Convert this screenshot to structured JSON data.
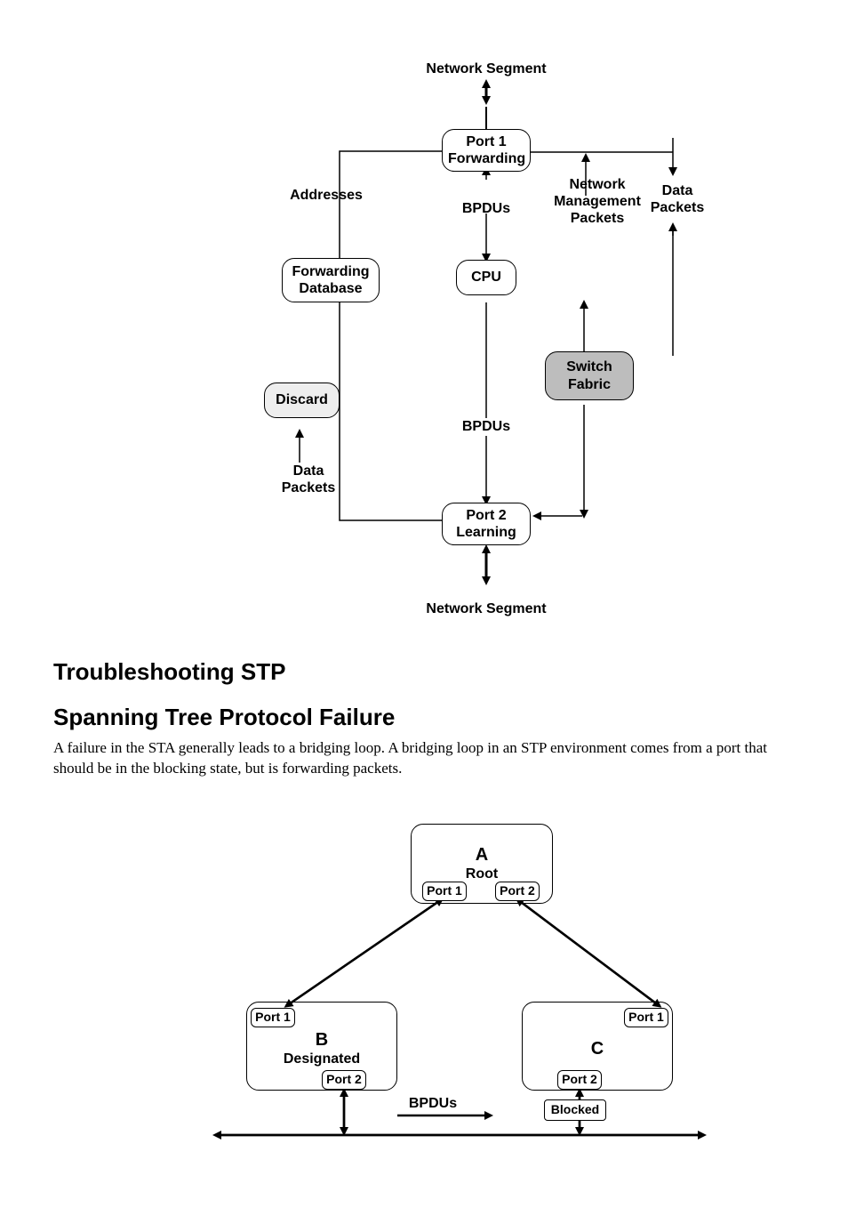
{
  "diagram1": {
    "topSegment": "Network Segment",
    "port1": {
      "line1": "Port 1",
      "line2": "Forwarding"
    },
    "addresses": "Addresses",
    "bpdus1": "BPDUs",
    "nmPackets": {
      "line1": "Network",
      "line2": "Management",
      "line3": "Packets"
    },
    "dataPackets1": {
      "line1": "Data",
      "line2": "Packets"
    },
    "forwardingDb": {
      "line1": "Forwarding",
      "line2": "Database"
    },
    "cpu": "CPU",
    "switchFabric": {
      "line1": "Switch",
      "line2": "Fabric"
    },
    "discard": "Discard",
    "bpdus2": "BPDUs",
    "dataPackets2": {
      "line1": "Data",
      "line2": "Packets"
    },
    "port2": {
      "line1": "Port 2",
      "line2": "Learning"
    },
    "bottomSegment": "Network Segment"
  },
  "headings": {
    "h1": "Troubleshooting STP",
    "h2": "Spanning Tree Protocol Failure"
  },
  "paragraph": "A failure in the STA generally leads to a bridging loop. A bridging loop in an STP environment comes from a port that should be in the blocking state, but is forwarding packets.",
  "diagram2": {
    "a": {
      "letter": "A",
      "role": "Root",
      "p1": "Port 1",
      "p2": "Port 2"
    },
    "b": {
      "letter": "B",
      "role": "Designated",
      "p1": "Port 1",
      "p2": "Port 2"
    },
    "c": {
      "letter": "C",
      "p1": "Port 1",
      "p2": "Port 2"
    },
    "bpdus": "BPDUs",
    "blocked": "Blocked"
  }
}
